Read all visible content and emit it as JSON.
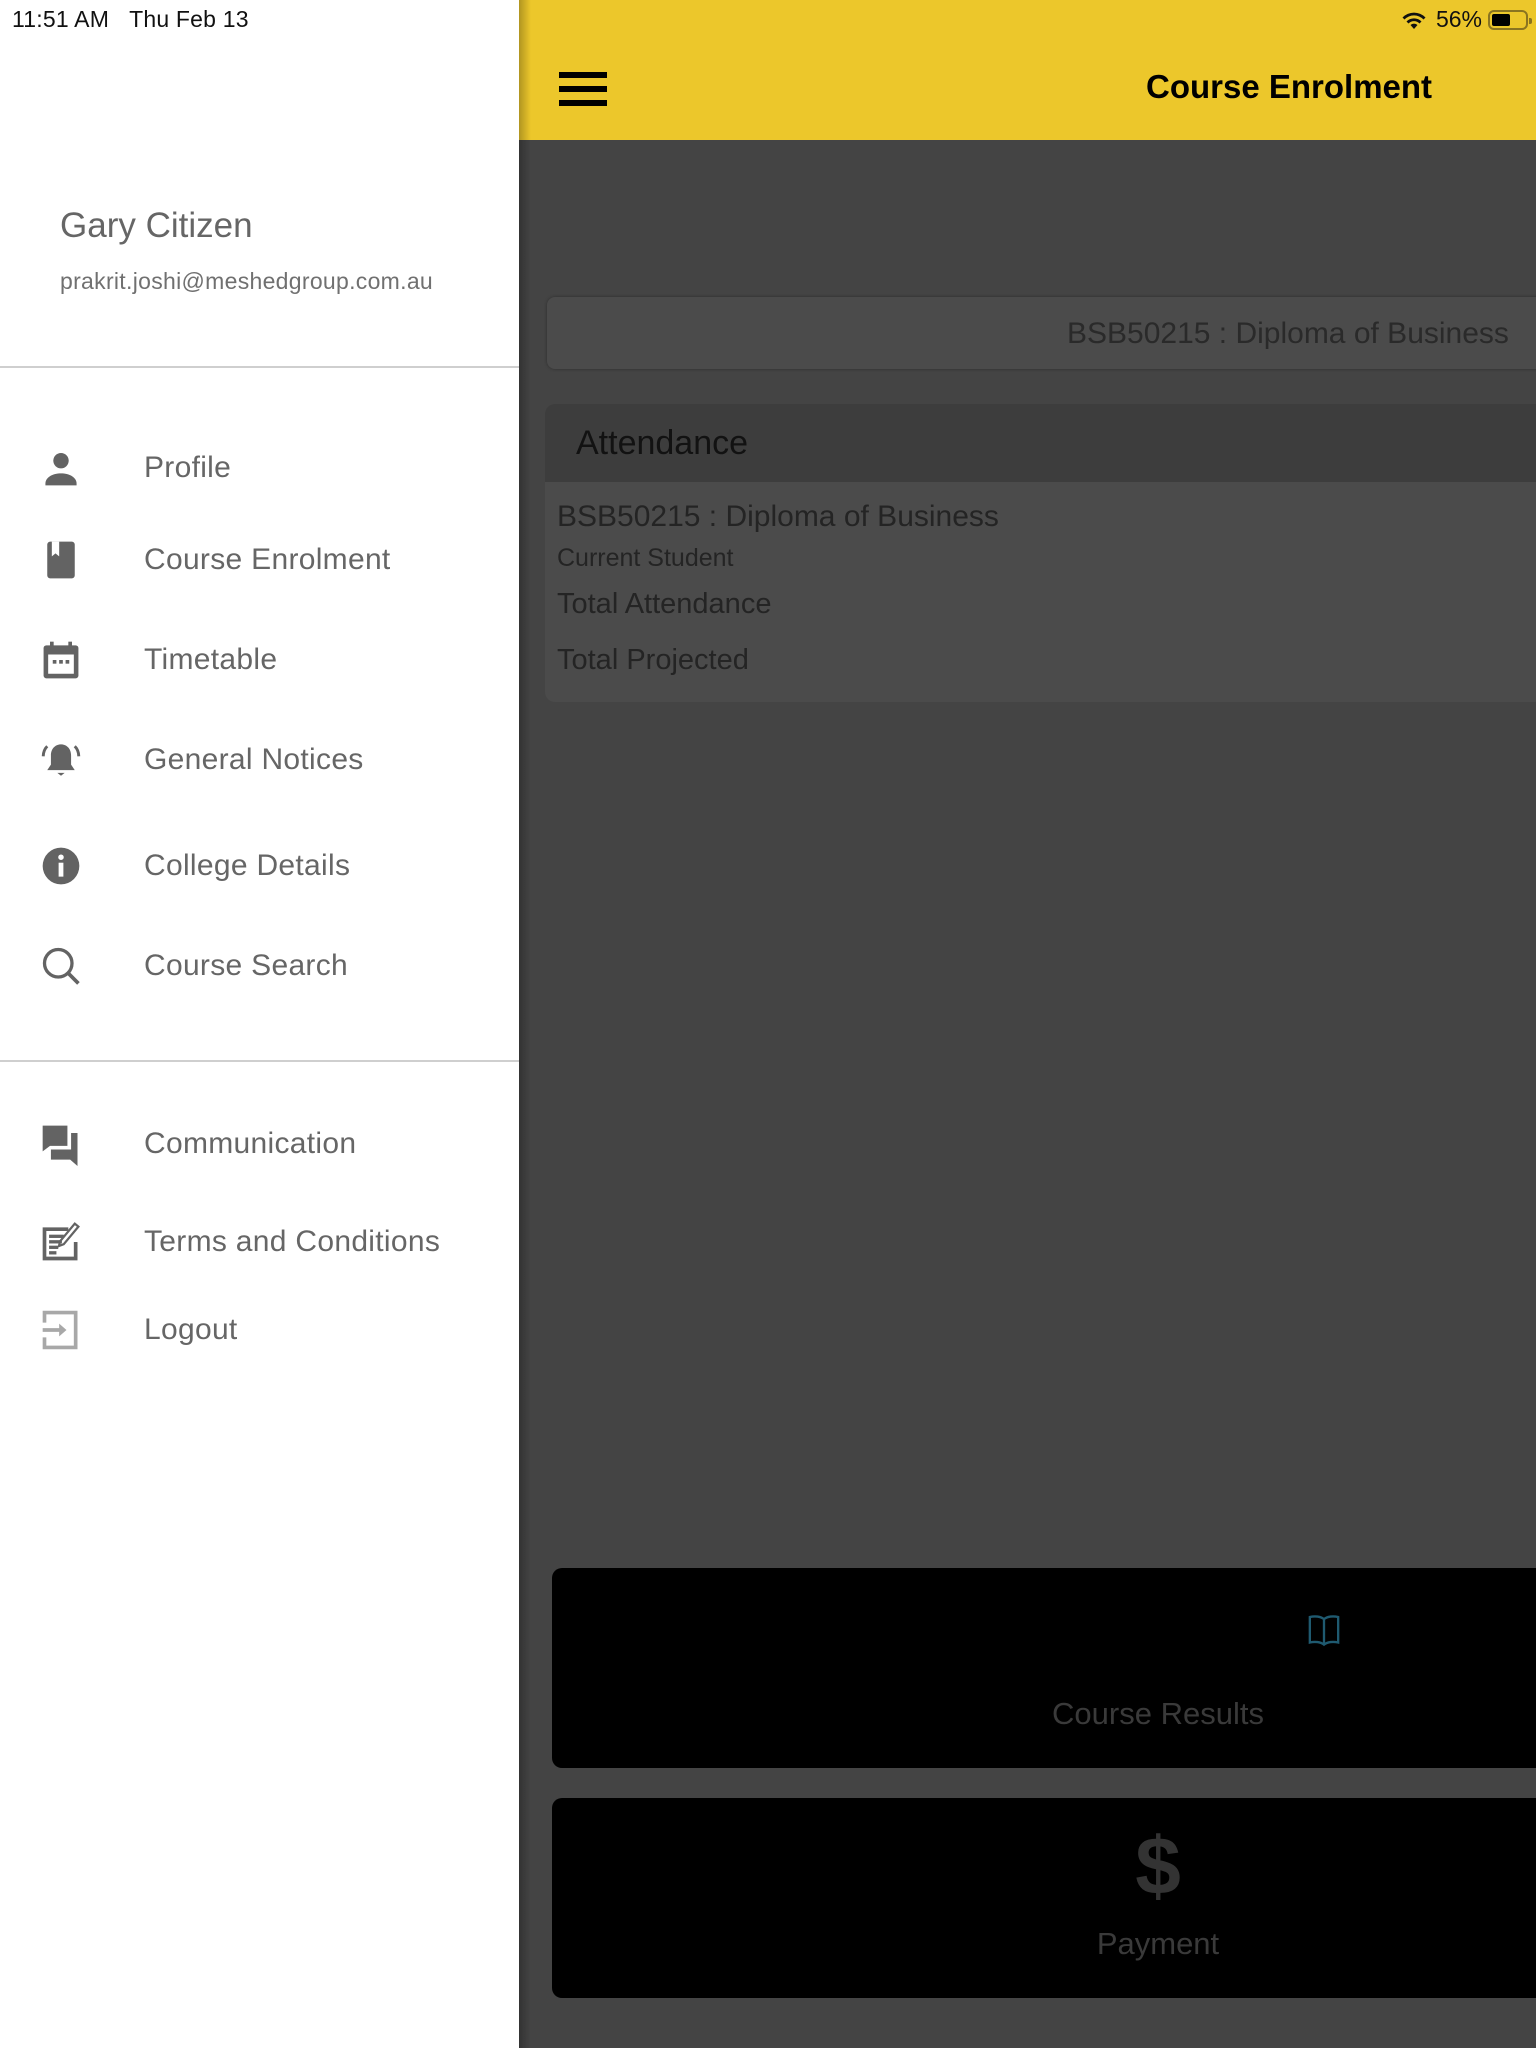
{
  "status_bar": {
    "time": "11:51 AM",
    "date": "Thu Feb 13",
    "battery_percent_label": "56%",
    "battery_level": 0.56,
    "wifi_icon": "wifi-icon"
  },
  "drawer": {
    "user": {
      "name": "Gary Citizen",
      "email": "prakrit.joshi@meshedgroup.com.au"
    },
    "primary_items": [
      {
        "label": "Profile",
        "icon": "person-icon"
      },
      {
        "label": "Course Enrolment",
        "icon": "book-bookmark-icon"
      },
      {
        "label": "Timetable",
        "icon": "calendar-icon"
      },
      {
        "label": "General Notices",
        "icon": "bell-ringing-icon"
      },
      {
        "label": "College Details",
        "icon": "info-icon"
      },
      {
        "label": "Course Search",
        "icon": "search-icon"
      }
    ],
    "secondary_items": [
      {
        "label": "Communication",
        "icon": "chat-bubbles-icon"
      },
      {
        "label": "Terms and Conditions",
        "icon": "document-edit-icon"
      },
      {
        "label": "Logout",
        "icon": "logout-icon"
      }
    ]
  },
  "header": {
    "title": "Course Enrolment",
    "menu_icon": "hamburger-icon",
    "background_color": "#ecc72b"
  },
  "main": {
    "course_selector": {
      "selected": "BSB50215 : Diploma of Business"
    },
    "attendance": {
      "title": "Attendance",
      "course": "BSB50215 : Diploma of Business",
      "status": "Current Student",
      "total_attendance_label": "Total Attendance",
      "total_projected_label": "Total Projected"
    },
    "actions": [
      {
        "label": "Course Results",
        "icon": "open-book-icon"
      },
      {
        "label": "Payment",
        "icon": "dollar-icon",
        "glyph": "$"
      }
    ]
  }
}
